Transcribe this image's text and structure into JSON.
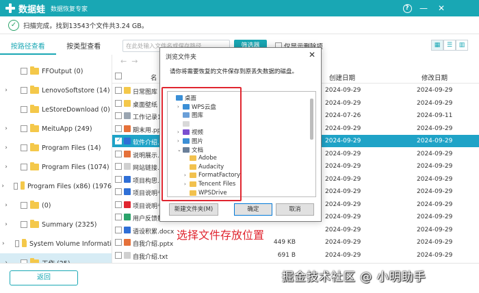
{
  "app": {
    "name": "数据蛙",
    "subtitle": "数据恢复专家",
    "help": "?",
    "minimize": "—",
    "close": "✕",
    "brand_color": "#19a7b4"
  },
  "status": {
    "text": "扫描完成，找到13543个文件共3.24 GB。"
  },
  "tabs": [
    {
      "label": "按路径查看",
      "active": true
    },
    {
      "label": "按类型查看",
      "active": false
    }
  ],
  "toolbar": {
    "search_placeholder": "在此处输入文件名或保存路径",
    "filter_label": "筛选器",
    "only_deleted_label": "仅显示删除项"
  },
  "tree": [
    {
      "label": "FFOutput (0)",
      "expandable": false
    },
    {
      "label": "LenovoSoftstore (14)",
      "expandable": true
    },
    {
      "label": "LeStoreDownload (0)",
      "expandable": false
    },
    {
      "label": "MeituApp (249)",
      "expandable": true
    },
    {
      "label": "Program Files (14)",
      "expandable": true
    },
    {
      "label": "Program Files (1074)",
      "expandable": true
    },
    {
      "label": "Program Files (x86) (1976",
      "expandable": true
    },
    {
      "label": "(0)",
      "expandable": true
    },
    {
      "label": "Summary (2325)",
      "expandable": true
    },
    {
      "label": "System Volume Informati",
      "expandable": true
    },
    {
      "label": "工作 (25)",
      "expandable": true
    }
  ],
  "file_list": {
    "headers": {
      "name": "名",
      "created": "创建日期",
      "modified": "修改日期"
    },
    "rows": [
      {
        "name": "日常图库",
        "size": "",
        "created": "2024-09-29",
        "modified": "2024-09-29",
        "icon_color": "#f4c84a",
        "selected": false
      },
      {
        "name": "桌面壁纸",
        "size": "",
        "created": "2024-09-29",
        "modified": "2024-09-29",
        "icon_color": "#f4c84a",
        "selected": false
      },
      {
        "name": "工作记录1.",
        "size": "",
        "created": "2024-07-26",
        "modified": "2024-09-11",
        "icon_color": "#9aa5b1",
        "selected": false
      },
      {
        "name": "期末用.ppt",
        "size": "",
        "created": "2024-09-29",
        "modified": "2024-09-29",
        "icon_color": "#e5713a",
        "selected": false
      },
      {
        "name": "软件介绍.",
        "size": "",
        "created": "2024-09-29",
        "modified": "2024-09-29",
        "icon_color": "#2f6fd6",
        "selected": true
      },
      {
        "name": "说明展示.p",
        "size": "",
        "created": "2024-09-29",
        "modified": "2024-09-29",
        "icon_color": "#e5713a",
        "selected": false
      },
      {
        "name": "网站链接.t",
        "size": "",
        "created": "2024-09-29",
        "modified": "2024-09-29",
        "icon_color": "#d0d0d0",
        "selected": false
      },
      {
        "name": "项目构思.d",
        "size": "",
        "created": "2024-09-29",
        "modified": "2024-09-29",
        "icon_color": "#2f6fd6",
        "selected": false
      },
      {
        "name": "项目说明书",
        "size": "",
        "created": "2024-09-29",
        "modified": "2024-09-29",
        "icon_color": "#2f6fd6",
        "selected": false
      },
      {
        "name": "项目说明书",
        "size": "",
        "created": "2024-09-29",
        "modified": "2024-09-29",
        "icon_color": "#e0252f",
        "selected": false
      },
      {
        "name": "用户反馈数",
        "size": "",
        "created": "2024-09-29",
        "modified": "2024-09-29",
        "icon_color": "#2ba36a",
        "selected": false
      },
      {
        "name": "语设积累.docx",
        "size": "",
        "created": "2024-09-29",
        "modified": "2024-09-29",
        "icon_color": "#2f6fd6",
        "selected": false
      },
      {
        "name": "自我介绍.pptx",
        "size": "449 KB",
        "created": "2024-09-29",
        "modified": "2024-09-29",
        "icon_color": "#e5713a",
        "selected": false
      },
      {
        "name": "自我介绍.txt",
        "size": "691 B",
        "created": "2024-09-29",
        "modified": "2024-09-29",
        "icon_color": "#d0d0d0",
        "selected": false
      }
    ]
  },
  "dialog": {
    "title": "浏览文件夹",
    "message": "请你将需要恢复的文件保存到原丢失数据的磁盘。",
    "tree": [
      {
        "label": "桌面",
        "indent": 0,
        "chev": "",
        "icon": "#3b8fd6"
      },
      {
        "label": "WPS云盘",
        "indent": 1,
        "chev": "›",
        "icon": "#3b8fd6"
      },
      {
        "label": "图库",
        "indent": 1,
        "chev": "",
        "icon": "#6a9fd8"
      },
      {
        "label": "",
        "indent": 1,
        "chev": "",
        "icon": "#d9d9d9"
      },
      {
        "label": "视频",
        "indent": 1,
        "chev": "›",
        "icon": "#7a4fd0"
      },
      {
        "label": "图片",
        "indent": 1,
        "chev": "›",
        "icon": "#3b8fd6"
      },
      {
        "label": "文档",
        "indent": 1,
        "chev": "⌄",
        "icon": "#6a7f99"
      },
      {
        "label": "Adobe",
        "indent": 2,
        "chev": "",
        "icon": "#f2c14e"
      },
      {
        "label": "Audacity",
        "indent": 2,
        "chev": "",
        "icon": "#f2c14e"
      },
      {
        "label": "FormatFactory",
        "indent": 2,
        "chev": "›",
        "icon": "#f2c14e"
      },
      {
        "label": "Tencent Files",
        "indent": 2,
        "chev": "›",
        "icon": "#f2c14e"
      },
      {
        "label": "WPSDrive",
        "indent": 2,
        "chev": "",
        "icon": "#f2c14e"
      }
    ],
    "new_folder": "新建文件夹(M)",
    "ok": "确定",
    "cancel": "取消"
  },
  "annotation": {
    "label": "选择文件存放位置",
    "color": "#e0252f"
  },
  "back_label": "返回",
  "watermark": "掘金技术社区 @ 小明助手"
}
